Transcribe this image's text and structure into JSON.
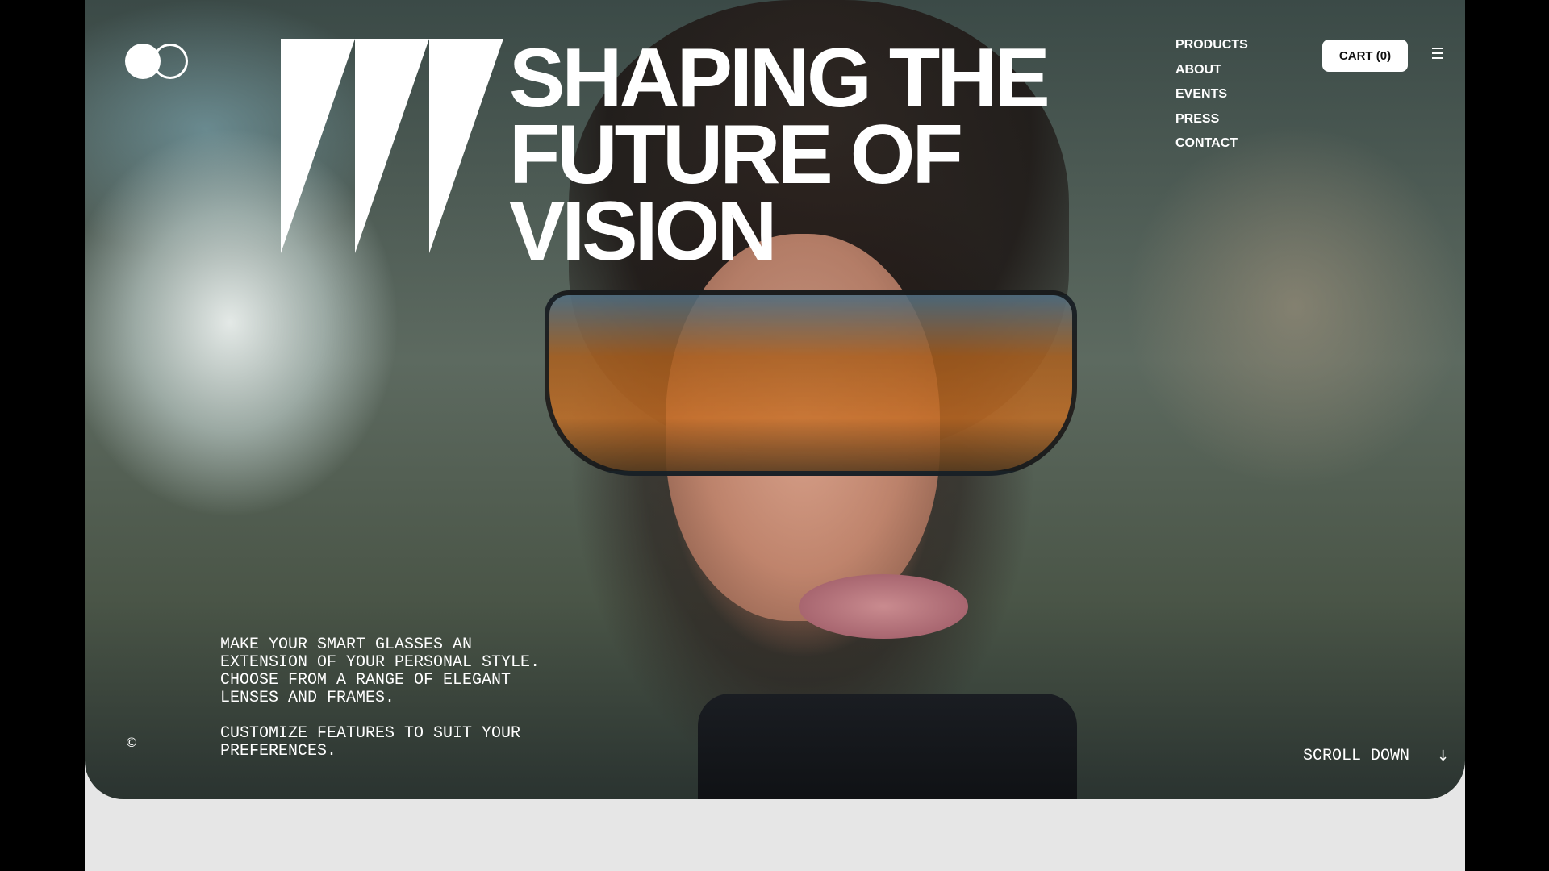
{
  "brand": {
    "logo_icon": "two-circles-logo",
    "mark_icon": "three-triangle-brand-mark"
  },
  "hero": {
    "headline": [
      "SHAPING THE",
      "FUTURE OF",
      "VISION"
    ],
    "tagline_paragraphs": [
      "MAKE YOUR SMART GLASSES AN EXTENSION OF YOUR PERSONAL STYLE. CHOOSE FROM A RANGE OF ELEGANT LENSES AND FRAMES.",
      "CUSTOMIZE FEATURES TO SUIT YOUR PREFERENCES."
    ],
    "image_description_icon": "woman-wearing-smart-goggles-photo"
  },
  "nav": {
    "items": [
      "PRODUCTS",
      "ABOUT",
      "EVENTS",
      "PRESS",
      "CONTACT"
    ]
  },
  "header": {
    "cart_label": "CART (0)",
    "menu_icon": "hamburger-menu-icon"
  },
  "footer": {
    "copyright_symbol": "©",
    "scroll_label": "SCROLL DOWN",
    "scroll_icon": "arrow-down-icon",
    "scroll_arrow": "↓"
  },
  "colors": {
    "text": "#ffffff",
    "page_background": "#e6e6e6",
    "outer_background": "#000000",
    "cart_button_bg": "#ffffff"
  }
}
